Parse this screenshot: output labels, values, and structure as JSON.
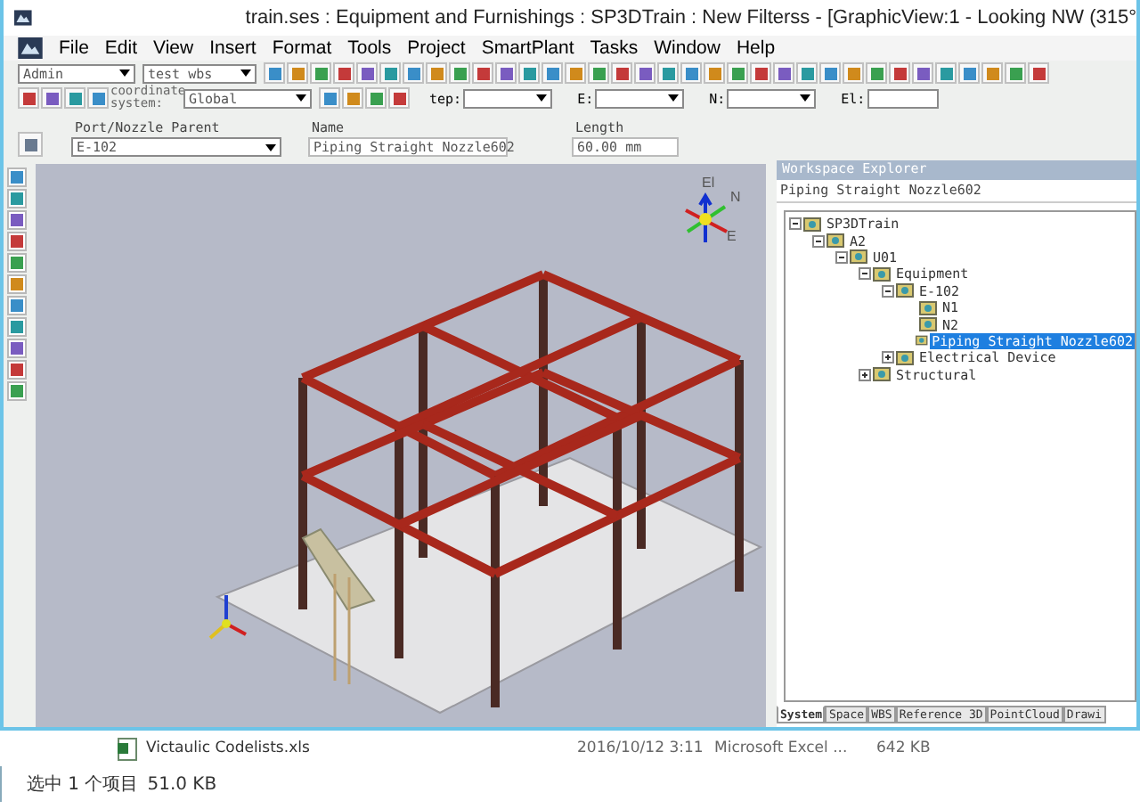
{
  "window": {
    "title": "train.ses : Equipment and Furnishings : SP3DTrain : New Filterss - [GraphicView:1 - Looking NW (315°"
  },
  "menu": [
    "File",
    "Edit",
    "View",
    "Insert",
    "Format",
    "Tools",
    "Project",
    "SmartPlant",
    "Tasks",
    "Window",
    "Help"
  ],
  "toolbar": {
    "permission": "Admin",
    "filter": "test wbs"
  },
  "locate_bar": {
    "coordinate_label": "coordinate system:",
    "coordinate_value": "Global",
    "step_label": "tep:",
    "e_label": "E:",
    "n_label": "N:",
    "el_label": "El:"
  },
  "properties": [
    {
      "label": "Port/Nozzle Parent",
      "value": "E-102",
      "kind": "dropdown"
    },
    {
      "label": "Name",
      "value": "Piping Straight Nozzle602",
      "kind": "text"
    },
    {
      "label": "Length",
      "value": "60.00 mm",
      "kind": "text"
    }
  ],
  "graphic_view": {
    "compass": {
      "up": "El",
      "north": "N",
      "east": "E"
    }
  },
  "explorer": {
    "title": "Workspace Explorer",
    "selection": "Piping Straight Nozzle602",
    "tree": [
      {
        "label": "SP3DTrain",
        "expanded": true,
        "selected": false,
        "children": [
          {
            "label": "A2",
            "expanded": true,
            "selected": false,
            "children": [
              {
                "label": "U01",
                "expanded": true,
                "selected": false,
                "children": [
                  {
                    "label": "Equipment",
                    "expanded": true,
                    "selected": false,
                    "children": [
                      {
                        "label": "E-102",
                        "expanded": true,
                        "selected": false,
                        "children": [
                          {
                            "label": "N1",
                            "selected": false
                          },
                          {
                            "label": "N2",
                            "selected": false
                          },
                          {
                            "label": "Piping Straight Nozzle602",
                            "selected": true
                          }
                        ]
                      },
                      {
                        "label": "Electrical Device",
                        "expanded": false,
                        "selected": false
                      }
                    ]
                  },
                  {
                    "label": "Structural",
                    "expanded": false,
                    "selected": false
                  }
                ]
              }
            ]
          }
        ]
      }
    ],
    "tabs": [
      {
        "label": "System",
        "selected": true
      },
      {
        "label": "Space",
        "selected": false
      },
      {
        "label": "WBS",
        "selected": false
      },
      {
        "label": "Reference 3D",
        "selected": false
      },
      {
        "label": "PointCloud",
        "selected": false
      },
      {
        "label": "Drawi",
        "selected": false
      }
    ]
  },
  "file_row": {
    "name": "Victaulic Codelists.xls",
    "date": "2016/10/12 3:11",
    "type": "Microsoft Excel ...",
    "size": "642 KB"
  },
  "status_bar": {
    "selection": "选中 1 个项目",
    "size": "51.0 KB"
  }
}
